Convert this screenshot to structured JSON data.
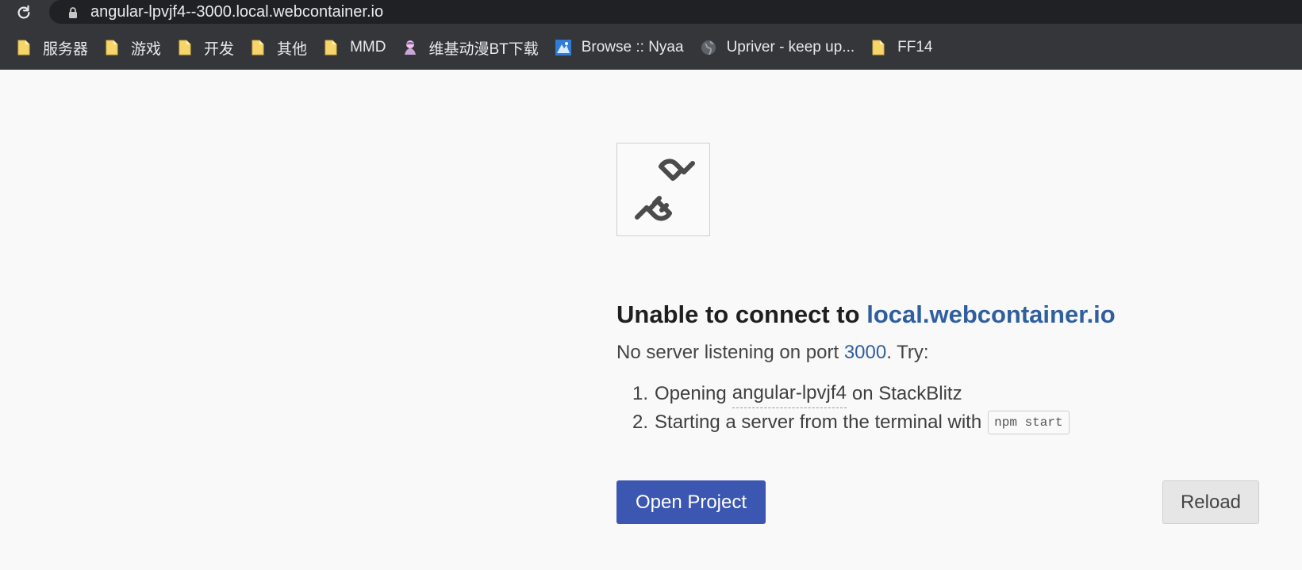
{
  "browser": {
    "url": "angular-lpvjf4--3000.local.webcontainer.io",
    "icons": {
      "reload": "reload-icon",
      "lock": "lock-icon"
    },
    "bookmarks": [
      {
        "label": "服务器",
        "icon": "folder-icon"
      },
      {
        "label": "游戏",
        "icon": "folder-icon"
      },
      {
        "label": "开发",
        "icon": "folder-icon"
      },
      {
        "label": "其他",
        "icon": "folder-icon"
      },
      {
        "label": "MMD",
        "icon": "folder-icon"
      },
      {
        "label": "维基动漫BT下载",
        "icon": "anime-site-icon"
      },
      {
        "label": "Browse :: Nyaa",
        "icon": "nyaa-site-icon"
      },
      {
        "label": "Upriver - keep up...",
        "icon": "globe-icon"
      },
      {
        "label": "FF14",
        "icon": "folder-icon"
      }
    ]
  },
  "error_page": {
    "icon": "plug-disconnected-icon",
    "heading_prefix": "Unable to connect to",
    "heading_host": "local.webcontainer.io",
    "message_prefix": "No server listening on port",
    "port": "3000",
    "message_suffix": ". Try:",
    "step1_number": "1.",
    "step1_prefix": "Opening",
    "step1_project": "angular-lpvjf4",
    "step1_suffix": "on StackBlitz",
    "step2_number": "2.",
    "step2_text": "Starting a server from the terminal with",
    "step2_command": "npm start",
    "open_button": "Open Project",
    "reload_button": "Reload"
  },
  "colors": {
    "chrome_bg": "#35363a",
    "omnibox_bg": "#202124",
    "page_bg": "#f9f9f9",
    "primary_button": "#3c57b1",
    "link": "#2f5f9f"
  }
}
